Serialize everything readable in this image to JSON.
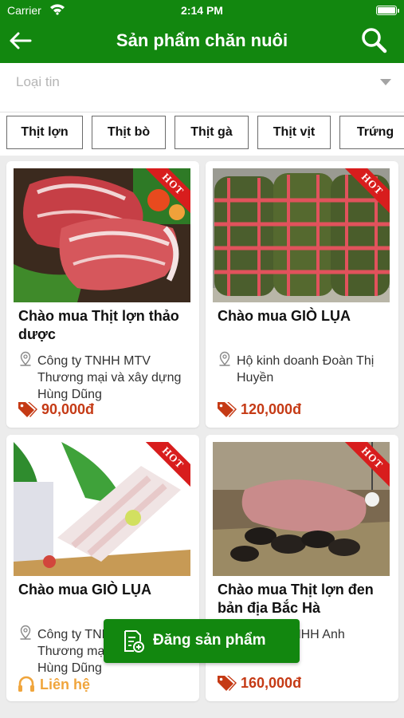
{
  "status_bar": {
    "carrier": "Carrier",
    "time": "2:14 PM"
  },
  "header": {
    "title": "Sản phẩm chăn nuôi",
    "back_icon": "arrow-left-icon",
    "search_icon": "search-icon"
  },
  "filter": {
    "placeholder": "Loại tin"
  },
  "categories": [
    "Thịt lợn",
    "Thịt bò",
    "Thịt gà",
    "Thịt vịt",
    "Trứng"
  ],
  "products": [
    {
      "title": "Chào mua Thịt lợn thảo dược",
      "company": "Công ty TNHH MTV Thương mại và xây dựng Hùng Dũng",
      "price": "90,000đ",
      "badge": "HOT"
    },
    {
      "title": "Chào mua GIÒ LỤA",
      "company": "Hộ kinh doanh Đoàn Thị Huyền",
      "price": "120,000đ",
      "badge": "HOT"
    },
    {
      "title": "Chào mua GIÒ LỤA",
      "company": "Công ty TNHH MTV Thương mại và xây dựng Hùng Dũng",
      "contact": "Liên hệ",
      "badge": "HOT"
    },
    {
      "title": "Chào mua Thịt lợn đen bản địa Bắc Hà",
      "company": "Công ty TNHH Anh",
      "price": "160,000đ",
      "badge": "HOT"
    }
  ],
  "fab": {
    "label": "Đăng sản phẩm",
    "icon": "add-document-icon"
  },
  "colors": {
    "primary": "#12870f",
    "price": "#c53a15",
    "contact": "#f0a53c",
    "hot": "#d81d1d"
  }
}
